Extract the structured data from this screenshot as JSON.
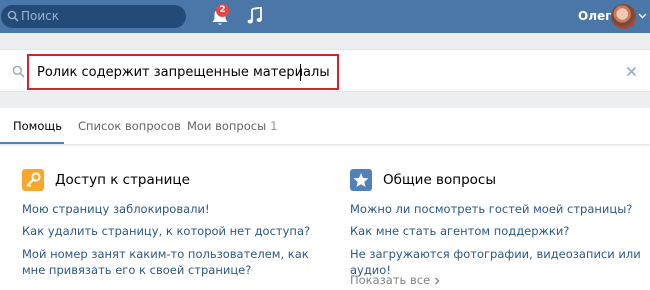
{
  "topbar": {
    "search_placeholder": "Поиск",
    "notifications_count": "2",
    "user_name": "Олег",
    "color": "#4a76a8"
  },
  "help_search": {
    "query": "Ролик содержит запрещенные материалы",
    "highlight_color": "#d2222d"
  },
  "tabs": [
    {
      "label": "Помощь",
      "active": true
    },
    {
      "label": "Список вопросов",
      "active": false
    },
    {
      "label": "Мои вопросы",
      "count": "1",
      "active": false
    }
  ],
  "sections": [
    {
      "title": "Доступ к странице",
      "icon": "key-icon",
      "icon_color": "#f8a72b",
      "links": [
        "Мою страницу заблокировали!",
        "Как удалить страницу, к которой нет доступа?",
        "Мой номер занят каким-то пользователем, как мне привязать его к своей странице?"
      ]
    },
    {
      "title": "Общие вопросы",
      "icon": "star-icon",
      "icon_color": "#5181b8",
      "links": [
        "Можно ли посмотреть гостей моей страницы?",
        "Как мне стать агентом поддержки?",
        "Не загружаются фотографии, видеозаписи или аудио!"
      ],
      "more_label": "Показать все"
    }
  ]
}
